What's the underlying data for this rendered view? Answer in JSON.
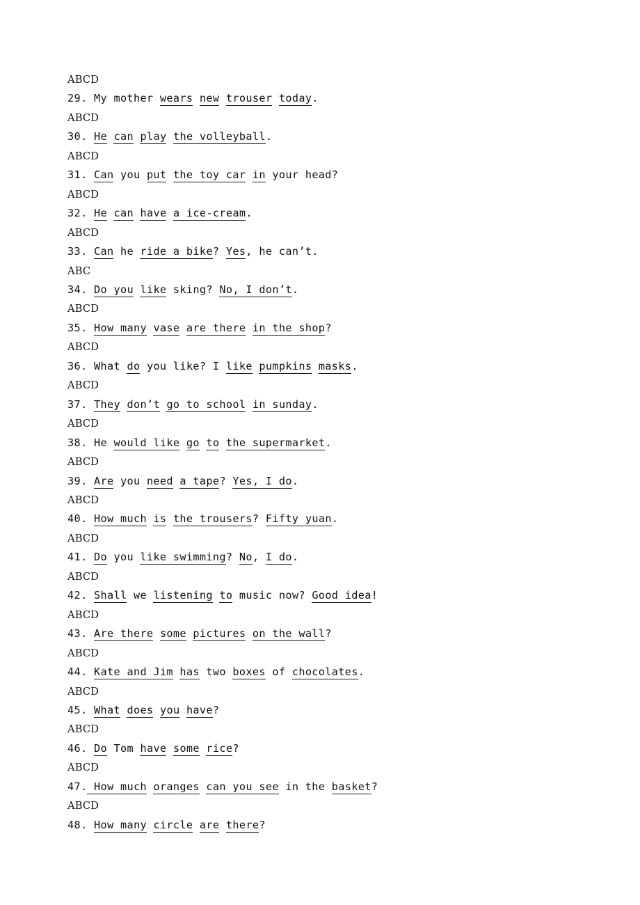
{
  "document": {
    "type": "english-exam-worksheet",
    "page_background": "#ffffff",
    "text_color": "#111111",
    "option_line_label": "ABCD",
    "lines": [
      {
        "kind": "options",
        "text": "ABCD"
      },
      {
        "kind": "question",
        "number": "29.",
        "text": "29. My mother wears new trouser today.",
        "runs": [
          {
            "t": "29. ",
            "u": false
          },
          {
            "t": "My mother ",
            "u": false
          },
          {
            "t": "wears",
            "u": true
          },
          {
            "t": " ",
            "u": false
          },
          {
            "t": "new",
            "u": true
          },
          {
            "t": " ",
            "u": false
          },
          {
            "t": "trouser",
            "u": true
          },
          {
            "t": " ",
            "u": false
          },
          {
            "t": "today",
            "u": true
          },
          {
            "t": ".",
            "u": false
          }
        ]
      },
      {
        "kind": "options",
        "text": "ABCD"
      },
      {
        "kind": "question",
        "number": "30.",
        "text": "30. He can play the volleyball.",
        "runs": [
          {
            "t": "30. ",
            "u": false
          },
          {
            "t": "He",
            "u": true
          },
          {
            "t": " ",
            "u": false
          },
          {
            "t": "can",
            "u": true
          },
          {
            "t": " ",
            "u": false
          },
          {
            "t": "play",
            "u": true
          },
          {
            "t": " ",
            "u": false
          },
          {
            "t": "the volleyball",
            "u": true
          },
          {
            "t": ".",
            "u": false
          }
        ]
      },
      {
        "kind": "options",
        "text": "ABCD"
      },
      {
        "kind": "question",
        "number": "31.",
        "text": "31. Can you put the toy car in your head?",
        "runs": [
          {
            "t": "31. ",
            "u": false
          },
          {
            "t": "Can",
            "u": true
          },
          {
            "t": " you ",
            "u": false
          },
          {
            "t": "put",
            "u": true
          },
          {
            "t": " ",
            "u": false
          },
          {
            "t": "the toy car",
            "u": true
          },
          {
            "t": " ",
            "u": false
          },
          {
            "t": "in",
            "u": true
          },
          {
            "t": " your head?",
            "u": false
          }
        ]
      },
      {
        "kind": "options",
        "text": "ABCD"
      },
      {
        "kind": "question",
        "number": "32.",
        "text": "32. He can have a ice-cream.",
        "runs": [
          {
            "t": "32. ",
            "u": false
          },
          {
            "t": "He",
            "u": true
          },
          {
            "t": " ",
            "u": false
          },
          {
            "t": "can",
            "u": true
          },
          {
            "t": " ",
            "u": false
          },
          {
            "t": "have",
            "u": true
          },
          {
            "t": " ",
            "u": false
          },
          {
            "t": "a ice-cream",
            "u": true
          },
          {
            "t": ".",
            "u": false
          }
        ]
      },
      {
        "kind": "options",
        "text": "ABCD"
      },
      {
        "kind": "question",
        "number": "33.",
        "text": "33. Can he ride a bike? Yes, he can't.",
        "runs": [
          {
            "t": "33. ",
            "u": false
          },
          {
            "t": "Can",
            "u": true
          },
          {
            "t": " he ",
            "u": false
          },
          {
            "t": "ride a bike",
            "u": true
          },
          {
            "t": "? ",
            "u": false
          },
          {
            "t": "Yes",
            "u": true
          },
          {
            "t": ", he can’t.",
            "u": false
          }
        ]
      },
      {
        "kind": "options",
        "text": "ABC"
      },
      {
        "kind": "question",
        "number": "34.",
        "text": "34. Do you like sking? No, I don't.",
        "runs": [
          {
            "t": "34. ",
            "u": false
          },
          {
            "t": "Do you",
            "u": true
          },
          {
            "t": " ",
            "u": false
          },
          {
            "t": "like",
            "u": true
          },
          {
            "t": " sking? ",
            "u": false
          },
          {
            "t": "No, I don’t",
            "u": true
          },
          {
            "t": ".",
            "u": false
          }
        ]
      },
      {
        "kind": "options",
        "text": "ABCD"
      },
      {
        "kind": "question",
        "number": "35.",
        "text": "35. How many vase are there in the shop?",
        "runs": [
          {
            "t": "35. ",
            "u": false
          },
          {
            "t": "How many",
            "u": true
          },
          {
            "t": " ",
            "u": false
          },
          {
            "t": "vase",
            "u": true
          },
          {
            "t": " ",
            "u": false
          },
          {
            "t": "are there",
            "u": true
          },
          {
            "t": " ",
            "u": false
          },
          {
            "t": "in the shop",
            "u": true
          },
          {
            "t": "?",
            "u": false
          }
        ]
      },
      {
        "kind": "options",
        "text": "ABCD"
      },
      {
        "kind": "question",
        "number": "36.",
        "text": "36. What do you like? I like pumpkins masks.",
        "runs": [
          {
            "t": "36. ",
            "u": false
          },
          {
            "t": "What ",
            "u": false
          },
          {
            "t": "do",
            "u": true
          },
          {
            "t": " you like? I ",
            "u": false
          },
          {
            "t": "like",
            "u": true
          },
          {
            "t": " ",
            "u": false
          },
          {
            "t": "pumpkins",
            "u": true
          },
          {
            "t": " ",
            "u": false
          },
          {
            "t": "masks",
            "u": true
          },
          {
            "t": ".",
            "u": false
          }
        ]
      },
      {
        "kind": "options",
        "text": "ABCD"
      },
      {
        "kind": "question",
        "number": "37.",
        "text": "37. They don't go to school in sunday.",
        "runs": [
          {
            "t": "37. ",
            "u": false
          },
          {
            "t": "They",
            "u": true
          },
          {
            "t": " ",
            "u": false
          },
          {
            "t": "don’t",
            "u": true
          },
          {
            "t": " ",
            "u": false
          },
          {
            "t": "go to school",
            "u": true
          },
          {
            "t": " ",
            "u": false
          },
          {
            "t": "in sunday",
            "u": true
          },
          {
            "t": ".",
            "u": false
          }
        ]
      },
      {
        "kind": "options",
        "text": "ABCD"
      },
      {
        "kind": "question",
        "number": "38.",
        "text": "38. He would like go to the supermarket.",
        "runs": [
          {
            "t": "38. ",
            "u": false
          },
          {
            "t": "He ",
            "u": false
          },
          {
            "t": "would like",
            "u": true
          },
          {
            "t": " ",
            "u": false
          },
          {
            "t": "go",
            "u": true
          },
          {
            "t": " ",
            "u": false
          },
          {
            "t": "to",
            "u": true
          },
          {
            "t": " ",
            "u": false
          },
          {
            "t": "the supermarket",
            "u": true
          },
          {
            "t": ".",
            "u": false
          }
        ]
      },
      {
        "kind": "options",
        "text": "ABCD"
      },
      {
        "kind": "question",
        "number": "39.",
        "text": "39. Are you need a tape? Yes, I do.",
        "runs": [
          {
            "t": "39. ",
            "u": false
          },
          {
            "t": "Are",
            "u": true
          },
          {
            "t": " you ",
            "u": false
          },
          {
            "t": "need",
            "u": true
          },
          {
            "t": " ",
            "u": false
          },
          {
            "t": "a tape",
            "u": true
          },
          {
            "t": "? ",
            "u": false
          },
          {
            "t": "Yes, I do",
            "u": true
          },
          {
            "t": ".",
            "u": false
          }
        ]
      },
      {
        "kind": "options",
        "text": "ABCD"
      },
      {
        "kind": "question",
        "number": "40.",
        "text": "40. How much is the trousers? Fifty yuan.",
        "runs": [
          {
            "t": "40. ",
            "u": false
          },
          {
            "t": "How much",
            "u": true
          },
          {
            "t": " ",
            "u": false
          },
          {
            "t": "is",
            "u": true
          },
          {
            "t": " ",
            "u": false
          },
          {
            "t": "the trousers",
            "u": true
          },
          {
            "t": "? ",
            "u": false
          },
          {
            "t": "Fifty yuan",
            "u": true
          },
          {
            "t": ".",
            "u": false
          }
        ]
      },
      {
        "kind": "options",
        "text": "ABCD"
      },
      {
        "kind": "question",
        "number": "41.",
        "text": "41. Do you like swimming? No, I do.",
        "runs": [
          {
            "t": "41. ",
            "u": false
          },
          {
            "t": "Do",
            "u": true
          },
          {
            "t": " you ",
            "u": false
          },
          {
            "t": "like swimming",
            "u": true
          },
          {
            "t": "? ",
            "u": false
          },
          {
            "t": "No",
            "u": true
          },
          {
            "t": ", ",
            "u": false
          },
          {
            "t": "I do",
            "u": true
          },
          {
            "t": ".",
            "u": false
          }
        ]
      },
      {
        "kind": "options",
        "text": "ABCD"
      },
      {
        "kind": "question",
        "number": "42.",
        "text": "42. Shall we listening to music now? Good idea!",
        "runs": [
          {
            "t": "42. ",
            "u": false
          },
          {
            "t": "Shall",
            "u": true
          },
          {
            "t": " we ",
            "u": false
          },
          {
            "t": "listening",
            "u": true
          },
          {
            "t": " ",
            "u": false
          },
          {
            "t": "to",
            "u": true
          },
          {
            "t": " music now? ",
            "u": false
          },
          {
            "t": "Good idea",
            "u": true
          },
          {
            "t": "!",
            "u": false
          }
        ]
      },
      {
        "kind": "options",
        "text": "ABCD"
      },
      {
        "kind": "question",
        "number": "43.",
        "text": "43. Are there some pictures on the wall?",
        "runs": [
          {
            "t": "43. ",
            "u": false
          },
          {
            "t": "Are there",
            "u": true
          },
          {
            "t": " ",
            "u": false
          },
          {
            "t": "some",
            "u": true
          },
          {
            "t": " ",
            "u": false
          },
          {
            "t": "pictures",
            "u": true
          },
          {
            "t": " ",
            "u": false
          },
          {
            "t": "on the wall",
            "u": true
          },
          {
            "t": "?",
            "u": false
          }
        ]
      },
      {
        "kind": "options",
        "text": "ABCD"
      },
      {
        "kind": "question",
        "number": "44.",
        "text": "44. Kate and Jim has two boxes of chocolates.",
        "runs": [
          {
            "t": "44. ",
            "u": false
          },
          {
            "t": "Kate and Jim",
            "u": true
          },
          {
            "t": " ",
            "u": false
          },
          {
            "t": "has",
            "u": true
          },
          {
            "t": " two ",
            "u": false
          },
          {
            "t": "boxes",
            "u": true
          },
          {
            "t": " of ",
            "u": false
          },
          {
            "t": "chocolates",
            "u": true
          },
          {
            "t": ".",
            "u": false
          }
        ]
      },
      {
        "kind": "options",
        "text": "ABCD"
      },
      {
        "kind": "question",
        "number": "45.",
        "text": "45. What does you have?",
        "runs": [
          {
            "t": "45. ",
            "u": false
          },
          {
            "t": "What",
            "u": true
          },
          {
            "t": " ",
            "u": false
          },
          {
            "t": "does",
            "u": true
          },
          {
            "t": " ",
            "u": false
          },
          {
            "t": "you",
            "u": true
          },
          {
            "t": " ",
            "u": false
          },
          {
            "t": "have",
            "u": true
          },
          {
            "t": "?",
            "u": false
          }
        ]
      },
      {
        "kind": "options",
        "text": "ABCD"
      },
      {
        "kind": "question",
        "number": "46.",
        "text": "46. Do Tom have some rice?",
        "runs": [
          {
            "t": "46. ",
            "u": false
          },
          {
            "t": "Do",
            "u": true
          },
          {
            "t": " Tom ",
            "u": false
          },
          {
            "t": "have",
            "u": true
          },
          {
            "t": " ",
            "u": false
          },
          {
            "t": "some",
            "u": true
          },
          {
            "t": " ",
            "u": false
          },
          {
            "t": "rice",
            "u": true
          },
          {
            "t": "?",
            "u": false
          }
        ]
      },
      {
        "kind": "options",
        "text": "ABCD"
      },
      {
        "kind": "question",
        "number": "47.",
        "text": "47. How much oranges can you see in the basket?",
        "runs": [
          {
            "t": "47.",
            "u": false
          },
          {
            "t": " How much",
            "u": true
          },
          {
            "t": " ",
            "u": false
          },
          {
            "t": "oranges",
            "u": true
          },
          {
            "t": " ",
            "u": false
          },
          {
            "t": "can you see",
            "u": true
          },
          {
            "t": " in the ",
            "u": false
          },
          {
            "t": "basket",
            "u": true
          },
          {
            "t": "?",
            "u": false
          }
        ]
      },
      {
        "kind": "options",
        "text": "ABCD"
      },
      {
        "kind": "question",
        "number": "48.",
        "text": "48. How many circle are there?",
        "runs": [
          {
            "t": "48. ",
            "u": false
          },
          {
            "t": "How many",
            "u": true
          },
          {
            "t": " ",
            "u": false
          },
          {
            "t": "circle",
            "u": true
          },
          {
            "t": " ",
            "u": false
          },
          {
            "t": "are",
            "u": true
          },
          {
            "t": " ",
            "u": false
          },
          {
            "t": "there",
            "u": true
          },
          {
            "t": "?",
            "u": false
          }
        ]
      }
    ]
  }
}
